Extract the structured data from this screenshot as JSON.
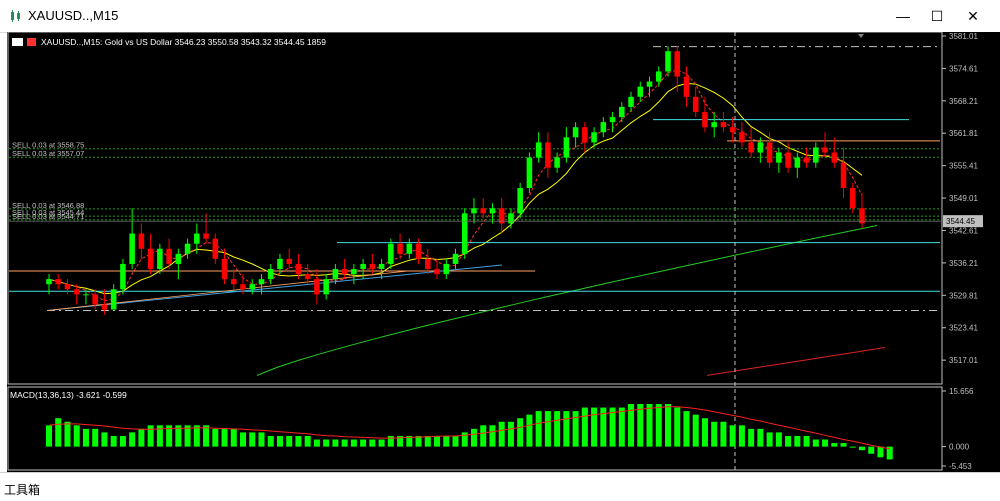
{
  "window": {
    "title": "XAUUSD..,M15",
    "minimize": "—",
    "maximize": "☐",
    "close": "✕"
  },
  "toolbox_label": "工具箱",
  "chart_data": {
    "type": "candlestick",
    "symbol_info": "XAUUSD..,M15:  Gold vs US Dollar  3546.23 3550.58 3543.32 3544.45  1859",
    "price_axis": {
      "ylim": [
        3512.3,
        3581.4
      ],
      "ticks": [
        "3581.01",
        "3574.61",
        "3568.21",
        "3561.81",
        "3555.41",
        "3549.01",
        "3542.61",
        "3536.21",
        "3529.81",
        "3523.41",
        "3517.01"
      ],
      "current_price": "3544.45"
    },
    "orders": [
      {
        "label": "SELL 0.03 at 3558.75",
        "price": 3558.75
      },
      {
        "label": "SELL 0.03 at 3557.07",
        "price": 3557.07
      },
      {
        "label": "SELL 0.03 at 3546.88",
        "price": 3546.88
      },
      {
        "label": "SELL 0.03 at 3545.44",
        "price": 3545.44
      },
      {
        "label": "SELL 0.03 at 3544.71",
        "price": 3544.71
      }
    ],
    "candles": [
      [
        3532,
        3534,
        3530,
        3533
      ],
      [
        3533,
        3534,
        3531,
        3532
      ],
      [
        3532,
        3533,
        3530,
        3531
      ],
      [
        3531,
        3532,
        3528,
        3530
      ],
      [
        3530,
        3531,
        3528,
        3530
      ],
      [
        3530,
        3531,
        3527,
        3528
      ],
      [
        3528,
        3531,
        3526,
        3527
      ],
      [
        3527,
        3532,
        3527,
        3531
      ],
      [
        3531,
        3537,
        3530,
        3536
      ],
      [
        3536,
        3547,
        3535,
        3542
      ],
      [
        3542,
        3544,
        3537,
        3539
      ],
      [
        3539,
        3542,
        3534,
        3535
      ],
      [
        3535,
        3540,
        3534,
        3539
      ],
      [
        3539,
        3541,
        3535,
        3536
      ],
      [
        3536,
        3539,
        3533,
        3538
      ],
      [
        3538,
        3541,
        3537,
        3540
      ],
      [
        3540,
        3544,
        3538,
        3542
      ],
      [
        3542,
        3546,
        3540,
        3541
      ],
      [
        3541,
        3542,
        3536,
        3537
      ],
      [
        3537,
        3539,
        3532,
        3533
      ],
      [
        3533,
        3535,
        3531,
        3532
      ],
      [
        3532,
        3534,
        3530,
        3531
      ],
      [
        3531,
        3533,
        3530,
        3532
      ],
      [
        3532,
        3534,
        3530,
        3533
      ],
      [
        3533,
        3536,
        3532,
        3535
      ],
      [
        3535,
        3538,
        3534,
        3537
      ],
      [
        3537,
        3539,
        3535,
        3536
      ],
      [
        3536,
        3538,
        3533,
        3534
      ],
      [
        3534,
        3536,
        3532,
        3533
      ],
      [
        3533,
        3535,
        3528,
        3530
      ],
      [
        3530,
        3534,
        3529,
        3533
      ],
      [
        3533,
        3536,
        3532,
        3535
      ],
      [
        3535,
        3537,
        3533,
        3534
      ],
      [
        3534,
        3536,
        3532,
        3535
      ],
      [
        3535,
        3537,
        3533,
        3536
      ],
      [
        3536,
        3538,
        3534,
        3535
      ],
      [
        3535,
        3537,
        3533,
        3536
      ],
      [
        3536,
        3541,
        3535,
        3540
      ],
      [
        3540,
        3542,
        3537,
        3538
      ],
      [
        3538,
        3541,
        3537,
        3540
      ],
      [
        3540,
        3541,
        3536,
        3537
      ],
      [
        3537,
        3539,
        3534,
        3535
      ],
      [
        3535,
        3537,
        3533,
        3534
      ],
      [
        3534,
        3537,
        3533,
        3536
      ],
      [
        3536,
        3539,
        3535,
        3538
      ],
      [
        3538,
        3547,
        3537,
        3546
      ],
      [
        3546,
        3549,
        3544,
        3547
      ],
      [
        3547,
        3549,
        3545,
        3546
      ],
      [
        3546,
        3548,
        3544,
        3547
      ],
      [
        3547,
        3549,
        3542,
        3544
      ],
      [
        3544,
        3547,
        3543,
        3546
      ],
      [
        3546,
        3552,
        3545,
        3551
      ],
      [
        3551,
        3558,
        3550,
        3557
      ],
      [
        3557,
        3562,
        3556,
        3560
      ],
      [
        3560,
        3562,
        3553,
        3555
      ],
      [
        3555,
        3558,
        3554,
        3557
      ],
      [
        3557,
        3563,
        3556,
        3561
      ],
      [
        3561,
        3564,
        3559,
        3563
      ],
      [
        3563,
        3564,
        3558,
        3560
      ],
      [
        3560,
        3563,
        3559,
        3562
      ],
      [
        3562,
        3565,
        3561,
        3564
      ],
      [
        3564,
        3566,
        3562,
        3565
      ],
      [
        3565,
        3568,
        3564,
        3567
      ],
      [
        3567,
        3570,
        3566,
        3569
      ],
      [
        3569,
        3572,
        3568,
        3571
      ],
      [
        3571,
        3573,
        3569,
        3572
      ],
      [
        3572,
        3575,
        3571,
        3574
      ],
      [
        3574,
        3579,
        3573,
        3578
      ],
      [
        3578,
        3579,
        3570,
        3573
      ],
      [
        3573,
        3575,
        3567,
        3569
      ],
      [
        3569,
        3571,
        3565,
        3566
      ],
      [
        3566,
        3569,
        3562,
        3563
      ],
      [
        3563,
        3566,
        3561,
        3564
      ],
      [
        3564,
        3566,
        3562,
        3563
      ],
      [
        3563,
        3565,
        3560,
        3562
      ],
      [
        3562,
        3564,
        3559,
        3560
      ],
      [
        3560,
        3563,
        3557,
        3558
      ],
      [
        3558,
        3561,
        3556,
        3560
      ],
      [
        3560,
        3562,
        3555,
        3556
      ],
      [
        3556,
        3559,
        3554,
        3558
      ],
      [
        3558,
        3560,
        3554,
        3555
      ],
      [
        3555,
        3558,
        3553,
        3557
      ],
      [
        3557,
        3559,
        3555,
        3556
      ],
      [
        3556,
        3560,
        3555,
        3559
      ],
      [
        3559,
        3562,
        3557,
        3558
      ],
      [
        3558,
        3561,
        3555,
        3556
      ],
      [
        3556,
        3559,
        3549,
        3551
      ],
      [
        3551,
        3552,
        3546,
        3547
      ],
      [
        3547,
        3550,
        3543,
        3544
      ]
    ],
    "moving_averages": [
      "yellow",
      "red-dashed",
      "lime-green",
      "red"
    ],
    "macd": {
      "label": "MACD(13,36,13) -3.621 -0.599",
      "axis_ticks": [
        "15.656",
        "0.000",
        "-5.453"
      ],
      "ylim": [
        -5.453,
        15.656
      ],
      "histogram": [
        6,
        8,
        7,
        6,
        5,
        5,
        4,
        3,
        3,
        4,
        5,
        6,
        6,
        6,
        6,
        6,
        6,
        6,
        5,
        5,
        5,
        4,
        4,
        4,
        3,
        3,
        3,
        3,
        3,
        2,
        2,
        2,
        2,
        2,
        2,
        2,
        2,
        3,
        3,
        3,
        3,
        3,
        3,
        3,
        3,
        4,
        5,
        6,
        6,
        7,
        7,
        8,
        9,
        10,
        10,
        10,
        10,
        10,
        11,
        11,
        11,
        11,
        11,
        12,
        12,
        12,
        12,
        12,
        11,
        10,
        9,
        8,
        7,
        7,
        6,
        6,
        5,
        5,
        4,
        4,
        3,
        3,
        3,
        2,
        2,
        1,
        1,
        0,
        -1,
        -2,
        -3,
        -3.6
      ],
      "signal": [
        6,
        6.3,
        6.4,
        6.4,
        6.2,
        6,
        5.8,
        5.5,
        5.2,
        5,
        4.9,
        4.9,
        5,
        5.1,
        5.2,
        5.2,
        5.3,
        5.3,
        5.2,
        5.1,
        5,
        4.9,
        4.7,
        4.6,
        4.4,
        4.2,
        4,
        3.8,
        3.6,
        3.3,
        3.1,
        3,
        2.8,
        2.7,
        2.6,
        2.5,
        2.4,
        2.4,
        2.5,
        2.6,
        2.7,
        2.8,
        2.9,
        3,
        3,
        3.2,
        3.5,
        3.8,
        4.2,
        4.6,
        5,
        5.4,
        6,
        6.6,
        7,
        7.4,
        7.8,
        8.2,
        8.6,
        9,
        9.3,
        9.6,
        9.9,
        10.2,
        10.5,
        10.8,
        11,
        11.2,
        11.2,
        11,
        10.7,
        10.3,
        9.8,
        9.3,
        8.8,
        8.3,
        7.7,
        7.2,
        6.6,
        6,
        5.5,
        4.9,
        4.3,
        3.8,
        3.2,
        2.6,
        2,
        1.5,
        1,
        0.4,
        -0.1,
        -0.6
      ]
    }
  }
}
